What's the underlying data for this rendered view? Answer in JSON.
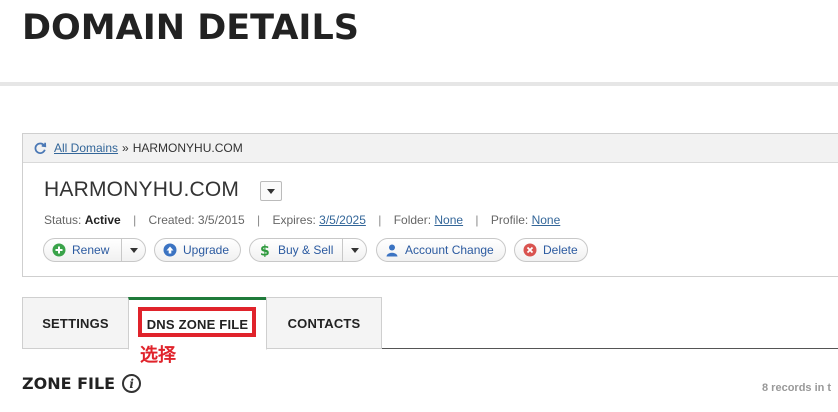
{
  "page": {
    "title": "DOMAIN DETAILS"
  },
  "breadcrumb": {
    "link": "All Domains",
    "separator": "»",
    "current": "HARMONYHU.COM"
  },
  "domain": {
    "name": "HARMONYHU.COM",
    "status_label": "Status:",
    "status_value": "Active",
    "created_label": "Created:",
    "created_value": "3/5/2015",
    "expires_label": "Expires:",
    "expires_value": "3/5/2025",
    "folder_label": "Folder:",
    "folder_value": "None",
    "profile_label": "Profile:",
    "profile_value": "None"
  },
  "actions": {
    "renew": "Renew",
    "upgrade": "Upgrade",
    "buy_sell": "Buy & Sell",
    "account_change": "Account Change",
    "delete": "Delete"
  },
  "tabs": [
    {
      "label": "SETTINGS"
    },
    {
      "label": "DNS ZONE FILE"
    },
    {
      "label": "CONTACTS"
    }
  ],
  "annotation": {
    "text": "选择"
  },
  "zone": {
    "title": "ZONE FILE",
    "records_text": "8 records in t"
  },
  "colors": {
    "active_tab_accent": "#1f7a3a",
    "annotation_red": "#e0232b",
    "link_blue": "#336699"
  },
  "icons": {
    "refresh": "refresh-icon",
    "renew": "plus-circle-icon",
    "upgrade": "up-arrow-circle-icon",
    "buy_sell": "dollar-icon",
    "account_change": "user-icon",
    "delete": "x-circle-icon",
    "info": "info-icon"
  }
}
